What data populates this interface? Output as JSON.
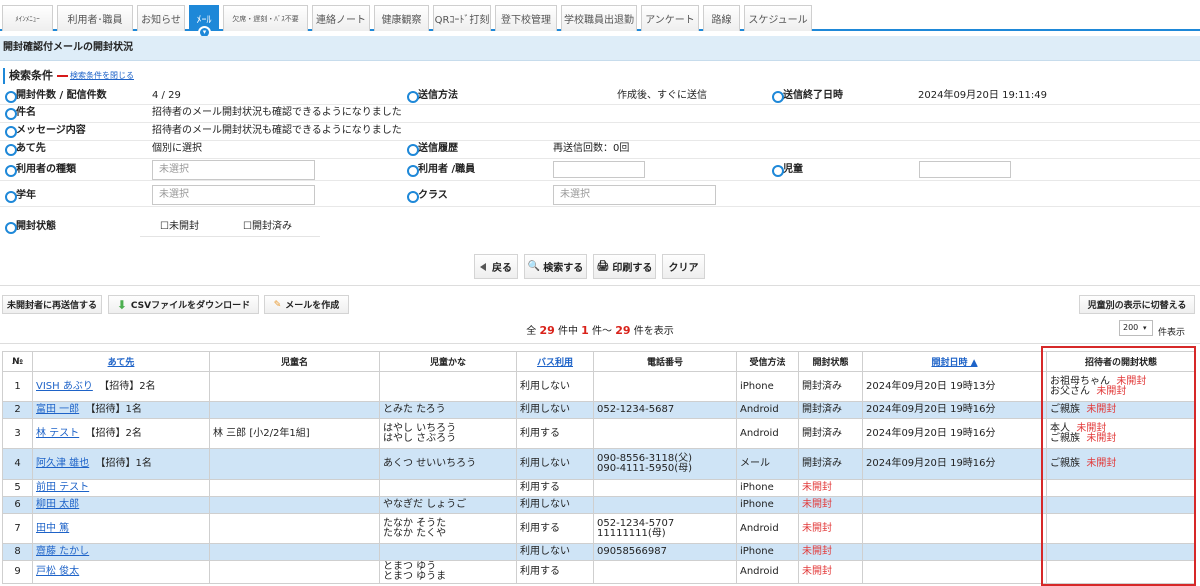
{
  "nav": {
    "tabs": [
      {
        "label": "ﾒｲﾝﾒﾆｭｰ",
        "active": false
      },
      {
        "label": "利用者･職員",
        "active": false
      },
      {
        "label": "お知らせ",
        "active": false
      },
      {
        "label": "ﾒｰﾙ",
        "active": true
      },
      {
        "label": "欠席・遅刻・ﾊﾞｽ不要",
        "active": false
      },
      {
        "label": "連絡ノート",
        "active": false
      },
      {
        "label": "健康観察",
        "active": false
      },
      {
        "label": "QRｺｰﾄﾞ打刻",
        "active": false
      },
      {
        "label": "登下校管理",
        "active": false
      },
      {
        "label": "学校職員出退勤",
        "active": false
      },
      {
        "label": "アンケート",
        "active": false
      },
      {
        "label": "路線",
        "active": false
      },
      {
        "label": "スケジュール",
        "active": false
      }
    ]
  },
  "page": {
    "title": "開封確認付メールの開封状況"
  },
  "criteria": {
    "title": "検索条件",
    "close_link": "検索条件を閉じる",
    "open_count_label": "開封件数 / 配信件数",
    "open_count_value": "4 / 29",
    "send_method_label": "送信方法",
    "send_method_value": "作成後、すぐに送信",
    "send_end_label": "送信終了日時",
    "send_end_value": "2024年09月20日 19:11:49",
    "subject_label": "件名",
    "subject_value": "招待者のメール開封状況も確認できるようになりました",
    "message_label": "メッセージ内容",
    "message_value": "招待者のメール開封状況も確認できるようになりました",
    "recipient_label": "あて先",
    "recipient_value": "個別に選択",
    "history_label": "送信履歴",
    "history_value": "再送信回数：0回",
    "user_type_label": "利用者の種類",
    "user_type_placeholder": "未選択",
    "user_staff_label": "利用者 /職員",
    "child_label": "児童",
    "grade_label": "学年",
    "grade_placeholder": "未選択",
    "class_label": "クラス",
    "class_placeholder": "未選択",
    "open_state_label": "開封状態",
    "unopened_label": "未開封",
    "opened_label": "開封済み"
  },
  "buttons": {
    "back": "戻る",
    "search": "検索する",
    "print": "印刷する",
    "clear": "クリア",
    "resend_unopened": "未開封者に再送信する",
    "download_csv": "CSVファイルをダウンロード",
    "create_mail": "メールを作成",
    "switch_child_view": "児童別の表示に切替える"
  },
  "summary": {
    "prefix": "全",
    "total": "29",
    "mid1": "件中",
    "from": "1",
    "mid2": "件～",
    "to": "29",
    "suffix": "件を表示",
    "page_size": "200",
    "display_label": "件表示"
  },
  "table": {
    "headers": [
      "№",
      "あて先",
      "児童名",
      "児童かな",
      "バス利用",
      "電話番号",
      "受信方法",
      "開封状態",
      "開封日時 ▲",
      "招待者の開封状態"
    ],
    "rows": [
      {
        "no": "1",
        "name": "VISH あぶり",
        "invite": "【招待】2名",
        "child": "",
        "kana1": "",
        "kana2": "",
        "bus": "利用しない",
        "phone1": "",
        "phone2": "",
        "method": "iPhone",
        "status": "開封済み",
        "date": "2024年09月20日 19時13分",
        "inv1": "お祖母ちゃん",
        "inv1s": "未開封",
        "inv2": "お父さん",
        "inv2s": "未開封",
        "alt": false
      },
      {
        "no": "2",
        "name": "富田 一郎",
        "invite": "【招待】1名",
        "child": "",
        "kana1": "とみた たろう",
        "kana2": "",
        "bus": "利用しない",
        "phone1": "052-1234-5687",
        "phone2": "",
        "method": "Android",
        "status": "開封済み",
        "date": "2024年09月20日 19時16分",
        "inv1": "ご親族",
        "inv1s": "未開封",
        "inv2": "",
        "inv2s": "",
        "alt": true
      },
      {
        "no": "3",
        "name": "林 テスト",
        "invite": "【招待】2名",
        "child": "林 三郎 [小2/2年1組]",
        "kana1": "はやし いちろう",
        "kana2": "はやし さぶろう",
        "bus": "利用する",
        "phone1": "",
        "phone2": "",
        "method": "Android",
        "status": "開封済み",
        "date": "2024年09月20日 19時16分",
        "inv1": "本人",
        "inv1s": "未開封",
        "inv2": "ご親族",
        "inv2s": "未開封",
        "alt": false
      },
      {
        "no": "4",
        "name": "阿久津 雄也",
        "invite": "【招待】1名",
        "child": "",
        "kana1": "あくつ せいいちろう",
        "kana2": "",
        "bus": "利用しない",
        "phone1": "090-8556-3118(父)",
        "phone2": "090-4111-5950(母)",
        "method": "メール",
        "status": "開封済み",
        "date": "2024年09月20日 19時16分",
        "inv1": "ご親族",
        "inv1s": "未開封",
        "inv2": "",
        "inv2s": "",
        "alt": true
      },
      {
        "no": "5",
        "name": "前田 テスト",
        "invite": "",
        "child": "",
        "kana1": "",
        "kana2": "",
        "bus": "利用する",
        "phone1": "",
        "phone2": "",
        "method": "iPhone",
        "status": "未開封",
        "date": "",
        "inv1": "",
        "inv1s": "",
        "inv2": "",
        "inv2s": "",
        "alt": false
      },
      {
        "no": "6",
        "name": "柳田 太郎",
        "invite": "",
        "child": "",
        "kana1": "やなぎだ しょうご",
        "kana2": "",
        "bus": "利用しない",
        "phone1": "",
        "phone2": "",
        "method": "iPhone",
        "status": "未開封",
        "date": "",
        "inv1": "",
        "inv1s": "",
        "inv2": "",
        "inv2s": "",
        "alt": true
      },
      {
        "no": "7",
        "name": "田中 篤",
        "invite": "",
        "child": "",
        "kana1": "たなか そうた",
        "kana2": "たなか たくや",
        "bus": "利用する",
        "phone1": "052-1234-5707",
        "phone2": "11111111(母)",
        "method": "Android",
        "status": "未開封",
        "date": "",
        "inv1": "",
        "inv1s": "",
        "inv2": "",
        "inv2s": "",
        "alt": false
      },
      {
        "no": "8",
        "name": "齋藤 たかし",
        "invite": "",
        "child": "",
        "kana1": "",
        "kana2": "",
        "bus": "利用しない",
        "phone1": "09058566987",
        "phone2": "",
        "method": "iPhone",
        "status": "未開封",
        "date": "",
        "inv1": "",
        "inv1s": "",
        "inv2": "",
        "inv2s": "",
        "alt": true
      },
      {
        "no": "9",
        "name": "戸松 俊太",
        "invite": "",
        "child": "",
        "kana1": "とまつ ゆう",
        "kana2": "とまつ ゆうま",
        "bus": "利用する",
        "phone1": "",
        "phone2": "",
        "method": "Android",
        "status": "未開封",
        "date": "",
        "inv1": "",
        "inv1s": "",
        "inv2": "",
        "inv2s": "",
        "alt": false
      }
    ]
  }
}
